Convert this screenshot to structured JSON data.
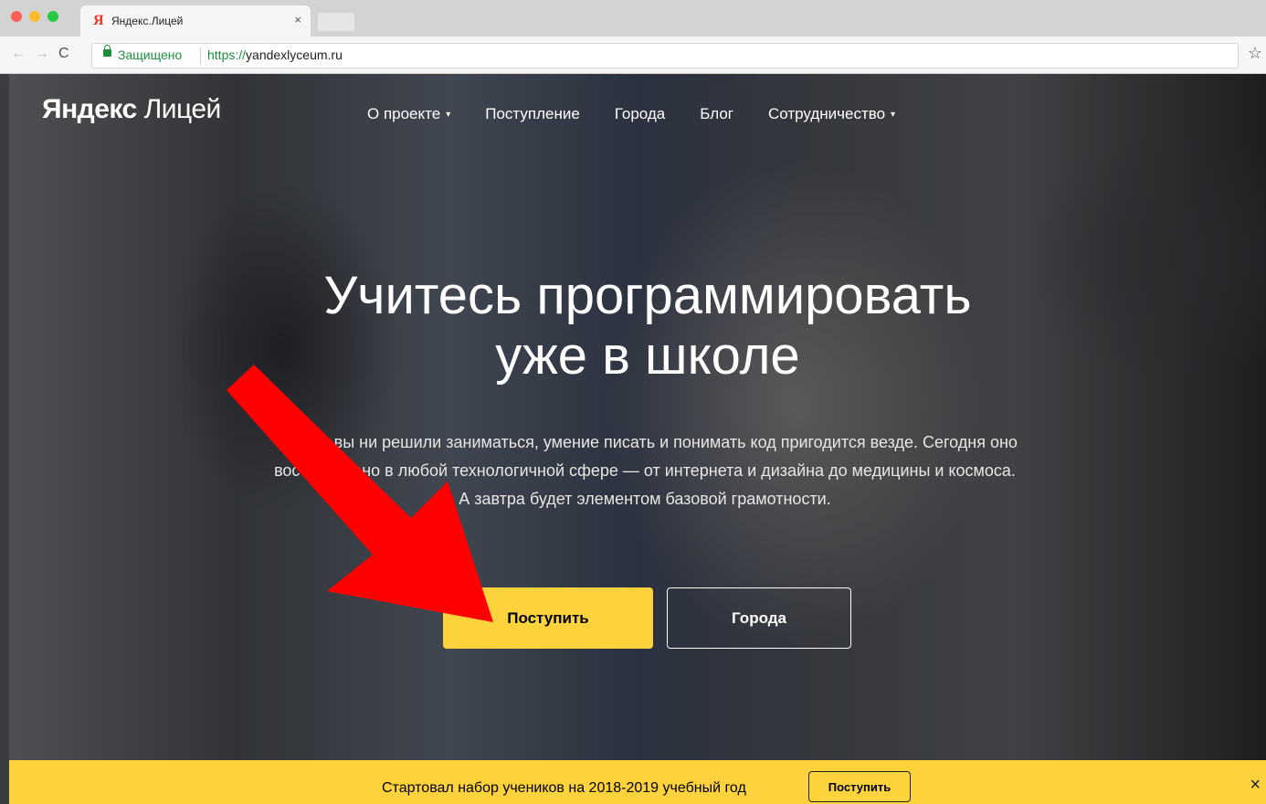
{
  "browser": {
    "tab_title": "Яндекс.Лицей",
    "tab_favicon": "Я",
    "tab_close": "×",
    "secure_label": "Защищено",
    "url_proto": "https://",
    "url_host": "yandexlyceum.ru",
    "back_icon": "←",
    "forward_icon": "→",
    "reload_icon": "C",
    "star_icon": "☆"
  },
  "header": {
    "brand_bold": "Яндекс",
    "brand_light": "Лицей",
    "nav": [
      {
        "label": "О проекте",
        "caret": "▾"
      },
      {
        "label": "Поступление"
      },
      {
        "label": "Города"
      },
      {
        "label": "Блог"
      },
      {
        "label": "Сотрудничество",
        "caret": "▾"
      }
    ]
  },
  "hero": {
    "title_line1": "Учитесь программировать",
    "title_line2": "уже в школе",
    "text_line1": "Чем бы вы ни решили заниматься, умение писать и понимать код пригодится везде. Сегодня оно",
    "text_line2": "востребовано в любой технологичной сфере — от интернета и дизайна до медицины и космоса.",
    "text_line3": "А завтра будет элементом базовой грамотности.",
    "primary_button": "Поступить",
    "secondary_button": "Города"
  },
  "banner": {
    "text": "Стартовал набор учеников на 2018-2019 учебный год",
    "button": "Поступить",
    "close_icon": "×"
  },
  "colors": {
    "accent_yellow": "#fcd23d",
    "annotation_arrow": "#ff0000",
    "secure_green": "#1e8e3e"
  }
}
